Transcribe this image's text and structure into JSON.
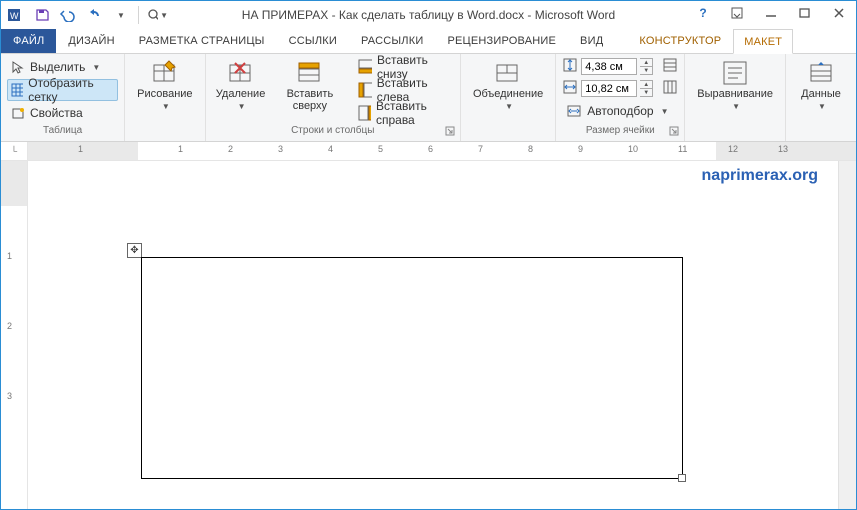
{
  "title": "НА ПРИМЕРАX - Как сделать таблицу в Word.docx - Microsoft Word",
  "watermark": "naprimerax.org",
  "tabs": {
    "file": "ФАЙЛ",
    "design": "ДИЗАЙН",
    "pageLayout": "РАЗМЕТКА СТРАНИЦЫ",
    "references": "ССЫЛКИ",
    "mailings": "РАССЫЛКИ",
    "review": "РЕЦЕНЗИРОВАНИЕ",
    "view": "ВИД",
    "ctxDesign": "КОНСТРУКТОР",
    "ctxLayout": "МАКЕТ"
  },
  "groups": {
    "table": "Таблица",
    "draw": "",
    "rowsCols": "Строки и столбцы",
    "merge": "",
    "cellSize": "Размер ячейки",
    "align": "",
    "data": ""
  },
  "cmds": {
    "select": "Выделить",
    "viewGrid": "Отобразить сетку",
    "properties": "Свойства",
    "draw": "Рисование",
    "delete": "Удаление",
    "insertAbove": "Вставить сверху",
    "insertBelow": "Вставить снизу",
    "insertLeft": "Вставить слева",
    "insertRight": "Вставить справа",
    "merge": "Объединение",
    "autofit": "Автоподбор",
    "align": "Выравнивание",
    "data": "Данные"
  },
  "cellSize": {
    "height": "4,38 см",
    "width": "10,82 см"
  },
  "ruler": {
    "h": [
      "1",
      "1",
      "2",
      "3",
      "4",
      "5",
      "6",
      "7",
      "8",
      "9",
      "10",
      "11",
      "12",
      "13"
    ],
    "v": [
      "1",
      "2",
      "3"
    ]
  }
}
